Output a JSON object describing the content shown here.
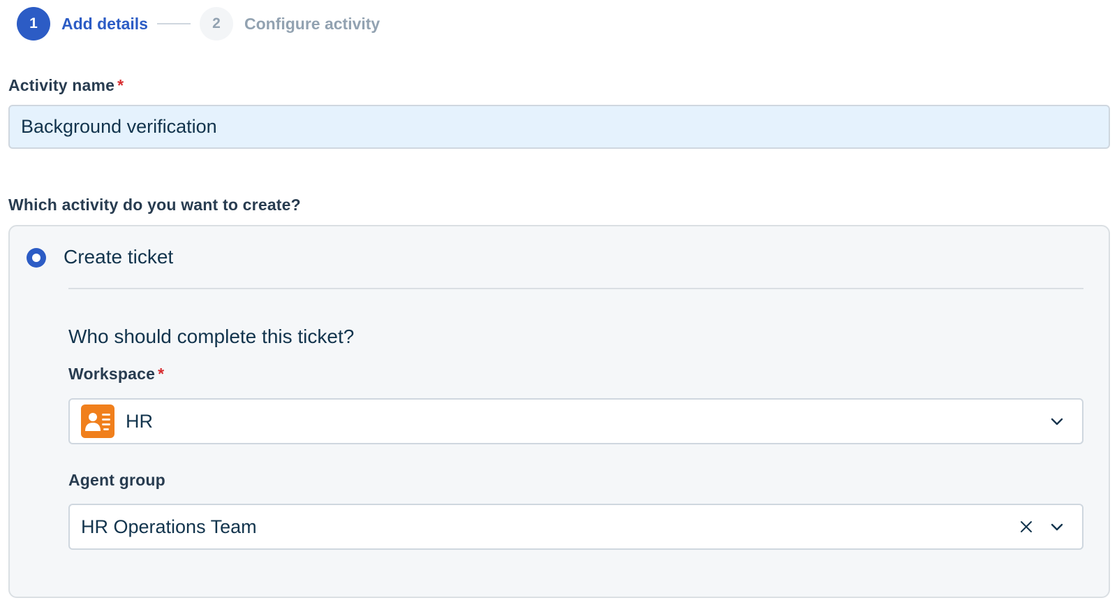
{
  "stepper": {
    "steps": [
      {
        "number": "1",
        "label": "Add details"
      },
      {
        "number": "2",
        "label": "Configure activity"
      }
    ]
  },
  "activity_name": {
    "label": "Activity name",
    "required_mark": "*",
    "value": "Background verification"
  },
  "activity_type": {
    "question": "Which activity do you want to create?",
    "selected_option": "Create ticket",
    "assignee_question": "Who should complete this ticket?",
    "workspace": {
      "label": "Workspace",
      "required_mark": "*",
      "value": "HR",
      "icon": "contact-card-icon"
    },
    "agent_group": {
      "label": "Agent group",
      "value": "HR Operations Team"
    }
  },
  "colors": {
    "accent": "#2c5cc5",
    "workspace_icon": "#f07f1c",
    "required": "#d72d30"
  }
}
